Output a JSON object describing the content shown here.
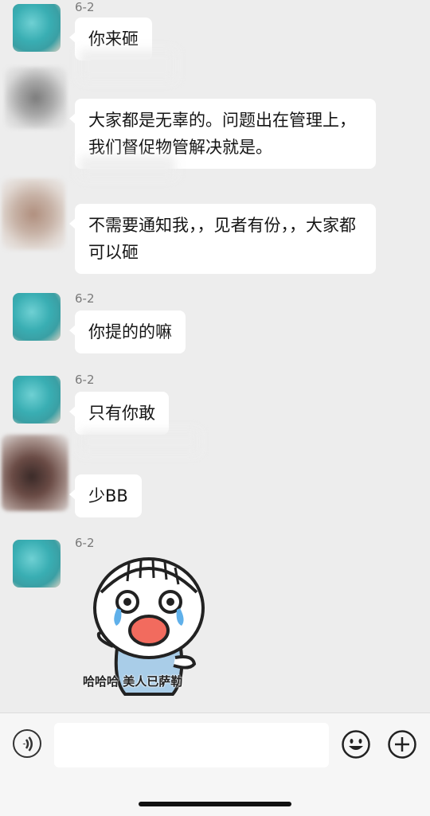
{
  "messages": [
    {
      "sender": "6-2",
      "text": "你来砸"
    },
    {
      "sender": "",
      "text": "大家都是无辜的。问题出在管理上，我们督促物管解决就是。"
    },
    {
      "sender": "",
      "text": "不需要通知我，，见者有份，，大家都可以砸"
    },
    {
      "sender": "6-2",
      "text": "你提的的嘛"
    },
    {
      "sender": "6-2",
      "text": "只有你敢"
    },
    {
      "sender": "",
      "text": "少BB"
    },
    {
      "sender": "6-2",
      "text": ""
    }
  ],
  "sticker": {
    "caption": "哈哈哈 美人已萨勒",
    "icon": "crying-laughing-face-icon"
  },
  "input_bar": {
    "placeholder": "",
    "voice_icon": "voice-icon",
    "emoji_icon": "emoji-icon",
    "plus_icon": "plus-icon"
  }
}
